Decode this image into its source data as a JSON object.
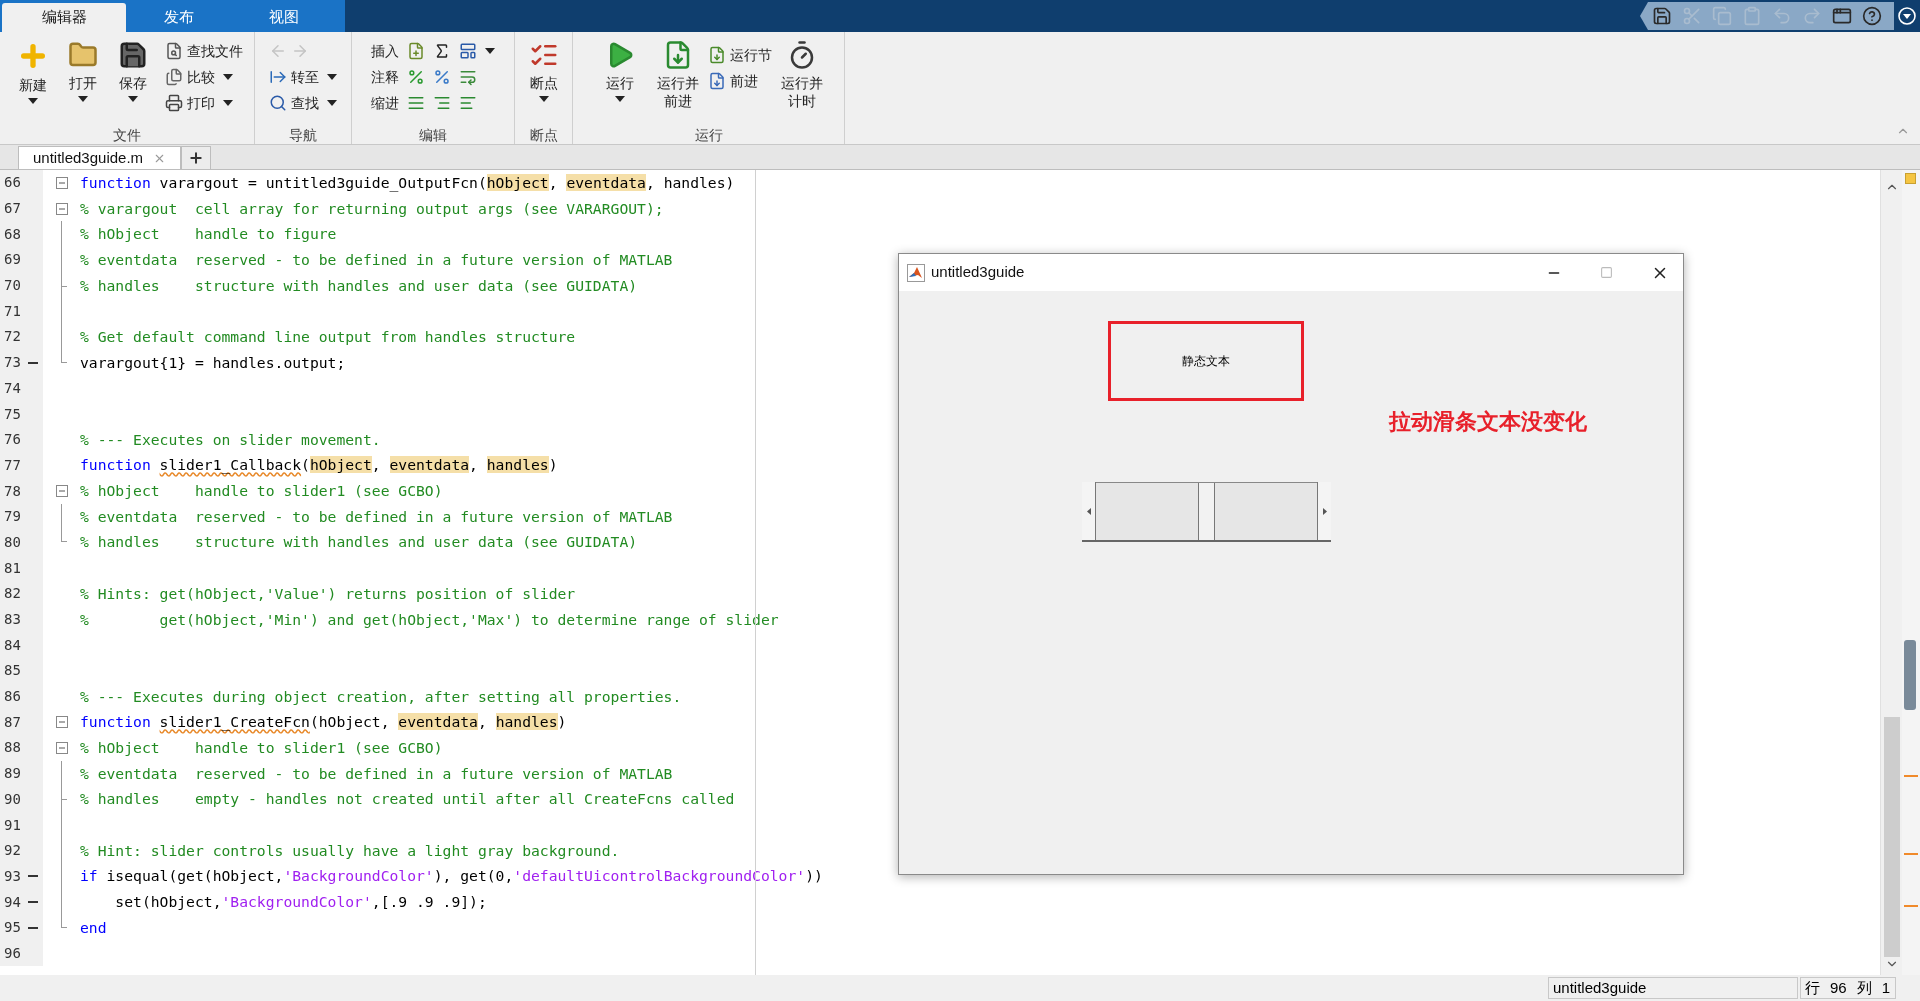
{
  "tabs": [
    {
      "label": "编辑器",
      "selected": true
    },
    {
      "label": "发布",
      "selected": false
    },
    {
      "label": "视图",
      "selected": false
    }
  ],
  "quick_access": [
    {
      "kind": "save",
      "disabled": false
    },
    {
      "kind": "cut",
      "disabled": true
    },
    {
      "kind": "copy",
      "disabled": true
    },
    {
      "kind": "paste",
      "disabled": true
    },
    {
      "kind": "undo",
      "disabled": true
    },
    {
      "kind": "redo",
      "disabled": true
    },
    {
      "kind": "layout",
      "disabled": false
    },
    {
      "kind": "help",
      "disabled": false
    },
    {
      "kind": "more",
      "disabled": false
    }
  ],
  "ribbon": {
    "file": {
      "label": "文件",
      "buttons": [
        {
          "label": "新建",
          "dropdown": true
        },
        {
          "label": "打开",
          "dropdown": true
        },
        {
          "label": "保存",
          "dropdown": true
        }
      ],
      "tools": [
        {
          "label": "查找文件",
          "dropdown": false
        },
        {
          "label": "比较",
          "dropdown": true
        },
        {
          "label": "打印",
          "dropdown": true
        }
      ]
    },
    "navigate": {
      "label": "导航",
      "history": [
        {
          "kind": "back",
          "disabled": true
        },
        {
          "kind": "forward",
          "disabled": true
        }
      ],
      "tools": [
        {
          "label": "转至",
          "dropdown": true
        },
        {
          "label": "查找",
          "dropdown": true
        }
      ]
    },
    "edit": {
      "label": "编辑",
      "rows": [
        {
          "label": "插入"
        },
        {
          "label": "注释"
        },
        {
          "label": "缩进"
        }
      ]
    },
    "breakpoints": {
      "label": "断点",
      "buttons": [
        {
          "label": "断点",
          "dropdown": true
        }
      ]
    },
    "run": {
      "label": "运行",
      "buttons": [
        {
          "label": "运行",
          "dropdown": true
        },
        {
          "label": "运行并前进",
          "dropdown": false
        }
      ],
      "tools": [
        {
          "label": "运行节"
        },
        {
          "label": "前进"
        }
      ],
      "timer_button": {
        "label": "运行并计时"
      }
    }
  },
  "document_tabs": [
    {
      "label": "untitled3guide.m",
      "selected": true
    }
  ],
  "code_lines": [
    {
      "number": "66",
      "executable": false,
      "kind": "foldstart",
      "tokens": [
        {
          "kind": "keyword",
          "text": "function"
        },
        {
          "kind": "plain",
          "text": " varargout = untitled3guide_OutputFcn("
        },
        {
          "kind": "highlight",
          "text": "hObject"
        },
        {
          "kind": "plain",
          "text": ", "
        },
        {
          "kind": "highlight",
          "text": "eventdata"
        },
        {
          "kind": "plain",
          "text": ", handles)"
        }
      ]
    },
    {
      "number": "67",
      "executable": false,
      "kind": "foldstart",
      "tokens": [
        {
          "kind": "comment",
          "text": "% varargout  cell array for returning output args (see VARARGOUT);"
        }
      ]
    },
    {
      "number": "68",
      "executable": false,
      "kind": "foldline",
      "tokens": [
        {
          "kind": "comment",
          "text": "% hObject    handle to figure"
        }
      ]
    },
    {
      "number": "69",
      "executable": false,
      "kind": "foldline",
      "tokens": [
        {
          "kind": "comment",
          "text": "% eventdata  reserved - to be defined in a future version of MATLAB"
        }
      ]
    },
    {
      "number": "70",
      "executable": false,
      "kind": "foldbranch",
      "tokens": [
        {
          "kind": "comment",
          "text": "% handles    structure with handles and user data (see GUIDATA)"
        }
      ]
    },
    {
      "number": "71",
      "executable": false,
      "kind": "foldline"
    },
    {
      "number": "72",
      "executable": false,
      "kind": "foldline",
      "tokens": [
        {
          "kind": "comment",
          "text": "% Get default command line output from handles structure"
        }
      ]
    },
    {
      "number": "73",
      "executable": true,
      "kind": "foldend",
      "tokens": [
        {
          "kind": "plain",
          "text": "varargout{1} = handles.output;"
        }
      ]
    },
    {
      "number": "74",
      "executable": false,
      "kind": "plain"
    },
    {
      "number": "75",
      "executable": false,
      "kind": "plain"
    },
    {
      "number": "76",
      "executable": false,
      "kind": "plain",
      "tokens": [
        {
          "kind": "comment",
          "text": "% --- Executes on slider movement."
        }
      ]
    },
    {
      "number": "77",
      "executable": false,
      "kind": "plain",
      "tokens": [
        {
          "kind": "keyword",
          "text": "function"
        },
        {
          "kind": "squiggle",
          "text": "slider1_Callback"
        },
        {
          "kind": "plain",
          "text": "("
        },
        {
          "kind": "highlight",
          "text": "hObject"
        },
        {
          "kind": "plain",
          "text": ", "
        },
        {
          "kind": "highlight",
          "text": "eventdata"
        },
        {
          "kind": "plain",
          "text": ", "
        },
        {
          "kind": "highlight",
          "text": "handles"
        },
        {
          "kind": "plain",
          "text": ")"
        }
      ]
    },
    {
      "number": "78",
      "executable": false,
      "kind": "foldstart",
      "tokens": [
        {
          "kind": "comment",
          "text": "% hObject    handle to slider1 (see GCBO)"
        }
      ]
    },
    {
      "number": "79",
      "executable": false,
      "kind": "foldline",
      "tokens": [
        {
          "kind": "comment",
          "text": "% eventdata  reserved - to be defined in a future version of MATLAB"
        }
      ]
    },
    {
      "number": "80",
      "executable": false,
      "kind": "foldend",
      "tokens": [
        {
          "kind": "comment",
          "text": "% handles    structure with handles and user data (see GUIDATA)"
        }
      ]
    },
    {
      "number": "81",
      "executable": false,
      "kind": "plain"
    },
    {
      "number": "82",
      "executable": false,
      "kind": "plain",
      "tokens": [
        {
          "kind": "comment",
          "text": "% Hints: get(hObject,'Value') returns position of slider"
        }
      ]
    },
    {
      "number": "83",
      "executable": false,
      "kind": "plain",
      "tokens": [
        {
          "kind": "comment",
          "text": "%        get(hObject,'Min') and get(hObject,'Max') to determine range of slider"
        }
      ]
    },
    {
      "number": "84",
      "executable": false,
      "kind": "plain"
    },
    {
      "number": "85",
      "executable": false,
      "kind": "plain"
    },
    {
      "number": "86",
      "executable": false,
      "kind": "plain",
      "tokens": [
        {
          "kind": "comment",
          "text": "% --- Executes during object creation, after setting all properties."
        }
      ]
    },
    {
      "number": "87",
      "executable": false,
      "kind": "foldstart",
      "tokens": [
        {
          "kind": "keyword",
          "text": "function"
        },
        {
          "kind": "squiggle",
          "text": "slider1_CreateFcn"
        },
        {
          "kind": "plain",
          "text": "(hObject, "
        },
        {
          "kind": "highlight",
          "text": "eventdata"
        },
        {
          "kind": "plain",
          "text": ", "
        },
        {
          "kind": "highlight",
          "text": "handles"
        },
        {
          "kind": "plain",
          "text": ")"
        }
      ]
    },
    {
      "number": "88",
      "executable": false,
      "kind": "foldstart",
      "tokens": [
        {
          "kind": "comment",
          "text": "% hObject    handle to slider1 (see GCBO)"
        }
      ]
    },
    {
      "number": "89",
      "executable": false,
      "kind": "foldline",
      "tokens": [
        {
          "kind": "comment",
          "text": "% eventdata  reserved - to be defined in a future version of MATLAB"
        }
      ]
    },
    {
      "number": "90",
      "executable": false,
      "kind": "foldbranch",
      "tokens": [
        {
          "kind": "comment",
          "text": "% handles    empty - handles not created until after all CreateFcns called"
        }
      ]
    },
    {
      "number": "91",
      "executable": false,
      "kind": "foldline"
    },
    {
      "number": "92",
      "executable": false,
      "kind": "foldline",
      "tokens": [
        {
          "kind": "comment",
          "text": "% Hint: slider controls usually have a light gray background."
        }
      ]
    },
    {
      "number": "93",
      "executable": true,
      "kind": "foldline",
      "tokens": [
        {
          "kind": "keyword",
          "text": "if"
        },
        {
          "kind": "plain",
          "text": " isequal(get(hObject,"
        },
        {
          "kind": "string",
          "text": "'BackgroundColor'"
        },
        {
          "kind": "plain",
          "text": "), get(0,"
        },
        {
          "kind": "string",
          "text": "'defaultUicontrolBackgroundColor'"
        },
        {
          "kind": "plain",
          "text": "))"
        }
      ]
    },
    {
      "number": "94",
      "executable": true,
      "kind": "foldline",
      "tokens": [
        {
          "kind": "plain",
          "text": "    set(hObject,"
        },
        {
          "kind": "string",
          "text": "'BackgroundColor'"
        },
        {
          "kind": "plain",
          "text": ",[.9 .9 .9]);"
        }
      ]
    },
    {
      "number": "95",
      "executable": true,
      "kind": "foldend",
      "tokens": [
        {
          "kind": "keyword",
          "text": "end"
        }
      ]
    },
    {
      "number": "96",
      "executable": false,
      "kind": "plain"
    }
  ],
  "figure": {
    "title": "untitled3guide",
    "static_text": "静态文本",
    "slider": {
      "level": 0.5
    },
    "annotation": "拉动滑条文本没变化"
  },
  "status_bar": {
    "file": "untitled3guide",
    "line_label": "行",
    "line": "96",
    "column_label": "列",
    "column": "1"
  }
}
